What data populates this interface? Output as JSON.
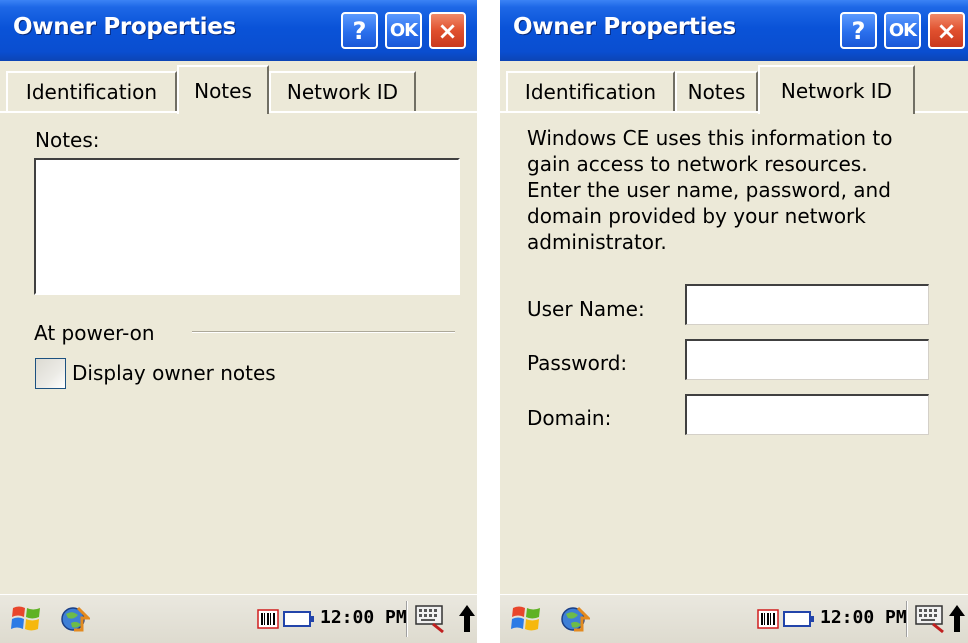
{
  "left": {
    "title": "Owner Properties",
    "buttons": {
      "help": "?",
      "ok": "OK",
      "close": "×"
    },
    "tabs": [
      "Identification",
      "Notes",
      "Network ID"
    ],
    "active_tab": "Notes",
    "notes_label": "Notes:",
    "notes_value": "",
    "group_label": "At power-on",
    "checkbox_label": "Display owner notes",
    "checkbox_checked": false,
    "clock": "12:00 PM"
  },
  "right": {
    "title": "Owner Properties",
    "buttons": {
      "help": "?",
      "ok": "OK",
      "close": "×"
    },
    "tabs": [
      "Identification",
      "Notes",
      "Network ID"
    ],
    "active_tab": "Network ID",
    "description_lines": [
      "Windows CE uses this information to",
      "gain access to network resources.",
      "Enter the user name, password, and",
      "domain provided by your network",
      "administrator."
    ],
    "fields": [
      {
        "label": "User Name:",
        "value": ""
      },
      {
        "label": "Password:",
        "value": ""
      },
      {
        "label": "Domain:",
        "value": ""
      }
    ],
    "clock": "12:00 PM"
  },
  "icons": {
    "start": "windows-start-icon",
    "app": "app-globe-icon",
    "barcode": "barcode-scanner-icon",
    "battery": "battery-icon",
    "keyboard": "keyboard-icon",
    "up_arrow": "up-arrow-icon"
  },
  "colors": {
    "titlebar": "#0a53d8",
    "close_button": "#e0502e",
    "window_bg": "#ece9d8"
  }
}
